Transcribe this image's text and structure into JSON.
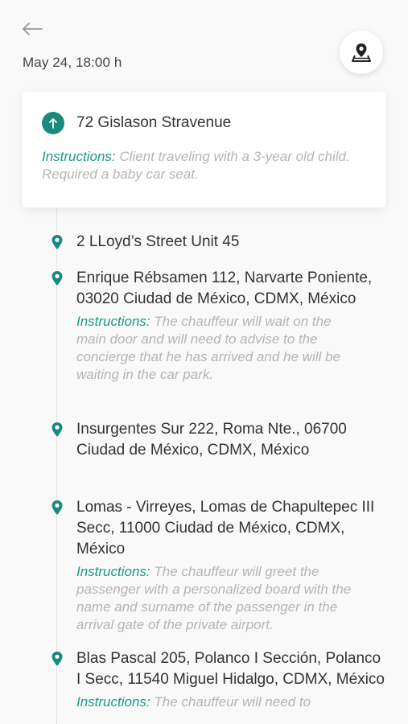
{
  "header": {
    "date": "May 24, 18:00 h",
    "back_icon": "arrow-left-icon",
    "map_icon": "map-pin-icon"
  },
  "colors": {
    "accent": "#1a8a7d",
    "instruction_label": "#1a9a8b",
    "instruction_text": "#b5b5b5"
  },
  "origin": {
    "address": "72 Gislason Stravenue",
    "instructions_label": "Instructions:",
    "instructions": "Client traveling with a 3-year old child. Required a baby car seat."
  },
  "stops": [
    {
      "address": "2 LLoyd’s Street Unit 45",
      "instructions_label": "",
      "instructions": ""
    },
    {
      "address": "Enrique Rébsamen 112, Narvarte Poniente, 03020 Ciudad de México, CDMX, México",
      "instructions_label": "Instructions:",
      "instructions": "The chauffeur will wait on the main door and will need to advise to the concierge that he has arrived and he will be waiting in the car park."
    },
    {
      "address": "Insurgentes Sur 222, Roma Nte., 06700 Ciudad de México, CDMX, México",
      "instructions_label": "",
      "instructions": ""
    },
    {
      "address": "Lomas - Virreyes, Lomas de Chapultepec III Secc, 11000 Ciudad de México, CDMX, México",
      "instructions_label": "Instructions:",
      "instructions": "The chauffeur will greet the passenger with a personalized board with the name and surname of the passenger in the arrival gate of the private airport."
    },
    {
      "address": "Blas Pascal 205, Polanco I Sección, Polanco I Secc, 11540 Miguel Hidalgo, CDMX, México",
      "instructions_label": "Instructions:",
      "instructions": "The chauffeur will need to"
    }
  ]
}
